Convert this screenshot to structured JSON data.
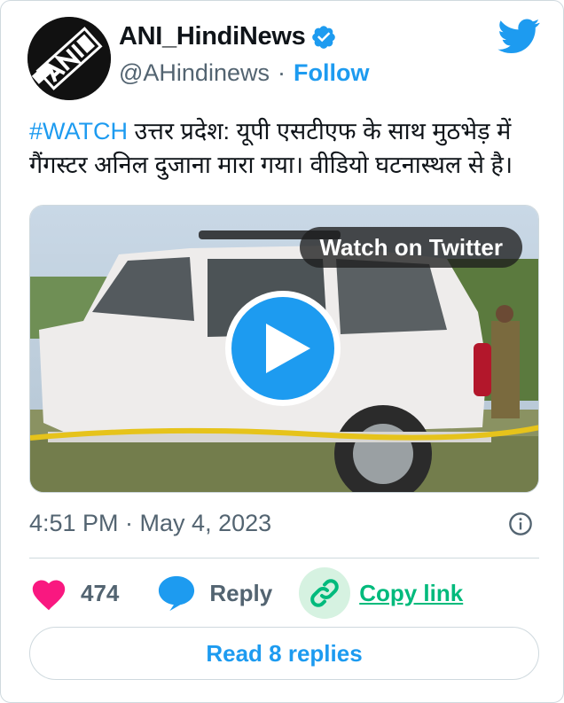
{
  "author": {
    "display_name": "ANI_HindiNews",
    "handle": "@AHindinews",
    "separator": "·",
    "follow_label": "Follow",
    "avatar_icon": "ani-logo-icon",
    "verified_icon": "verified-badge-icon"
  },
  "platform_icon": "twitter-bird-icon",
  "tweet": {
    "hashtag": "#WATCH",
    "text": " उत्तर प्रदेश: यूपी एसटीएफ के साथ मुठभेड़ में गैंगस्टर अनिल दुजाना मारा गया। वीडियो घटनास्थल से है।"
  },
  "media": {
    "watch_label": "Watch on Twitter",
    "play_icon": "play-icon"
  },
  "timestamp": "4:51 PM · May 4, 2023",
  "actions": {
    "like_count": "474",
    "reply_label": "Reply",
    "copy_link_label": "Copy link"
  },
  "read_replies_label": "Read 8 replies",
  "colors": {
    "accent": "#1d9bf0",
    "like": "#f91880",
    "copy": "#00ba7c",
    "muted_text": "#536471"
  }
}
